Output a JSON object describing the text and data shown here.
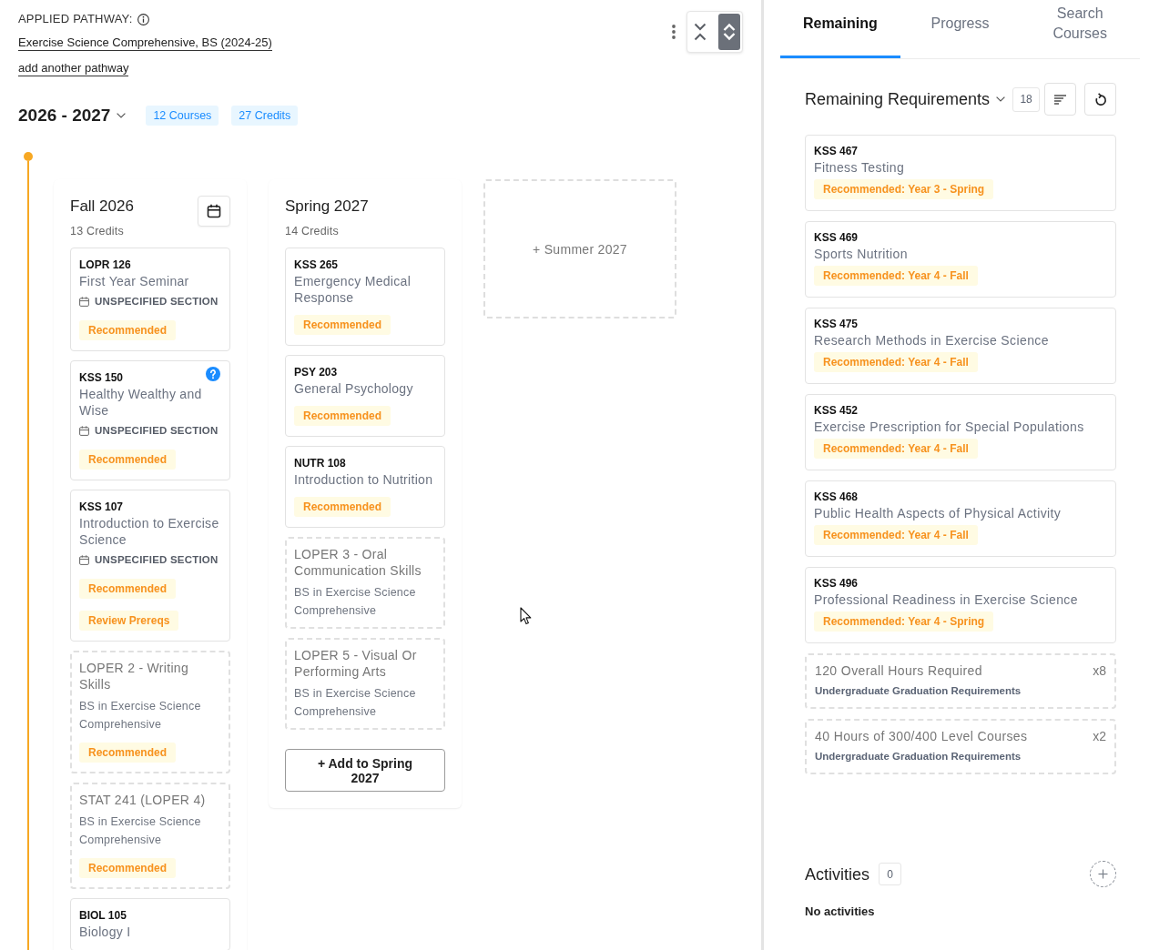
{
  "pathway": {
    "label": "APPLIED PATHWAY:",
    "name": "Exercise Science Comprehensive, BS (2024-25)",
    "add_link": "add another pathway"
  },
  "toolbar": {
    "view_toggle": [
      {
        "kind": "collapse",
        "selected": false
      },
      {
        "kind": "expand",
        "selected": true
      }
    ]
  },
  "year": {
    "title": "2026 - 2027",
    "badges": [
      "12 Courses",
      "27 Credits"
    ]
  },
  "terms": [
    {
      "kind": "term",
      "title": "Fall 2026",
      "credits": "13 Credits",
      "calendar_button": true,
      "cards": [
        {
          "kind": "course",
          "code": "LOPR 126",
          "title": "First Year Seminar",
          "section": "UNSPECIFIED SECTION",
          "help": false,
          "badges": [
            "Recommended"
          ]
        },
        {
          "kind": "course",
          "code": "KSS 150",
          "title": "Healthy Wealthy and Wise",
          "section": "UNSPECIFIED SECTION",
          "help": true,
          "badges": [
            "Recommended"
          ]
        },
        {
          "kind": "course",
          "code": "KSS 107",
          "title": "Introduction to Exercise Science",
          "section": "UNSPECIFIED SECTION",
          "help": false,
          "badges": [
            "Recommended",
            "Review Prereqs"
          ]
        },
        {
          "kind": "requirement",
          "title": "LOPER 2 - Writing Skills",
          "program": "BS in Exercise Science Comprehensive",
          "badges": [
            "Recommended"
          ]
        },
        {
          "kind": "requirement",
          "title": "STAT 241 (LOPER 4)",
          "program": "BS in Exercise Science Comprehensive",
          "badges": [
            "Recommended"
          ]
        },
        {
          "kind": "course",
          "code": "BIOL 105",
          "title": "Biology I",
          "help": false
        }
      ]
    },
    {
      "kind": "term",
      "title": "Spring 2027",
      "credits": "14 Credits",
      "calendar_button": false,
      "cards": [
        {
          "kind": "course",
          "code": "KSS 265",
          "title": "Emergency Medical Response",
          "help": false,
          "badges": [
            "Recommended"
          ]
        },
        {
          "kind": "course",
          "code": "PSY 203",
          "title": "General Psychology",
          "help": false,
          "badges": [
            "Recommended"
          ]
        },
        {
          "kind": "course",
          "code": "NUTR 108",
          "title": "Introduction to Nutrition",
          "help": false,
          "badges": [
            "Recommended"
          ]
        },
        {
          "kind": "requirement",
          "title": "LOPER 3 - Oral Communication Skills",
          "program": "BS in Exercise Science Comprehensive"
        },
        {
          "kind": "requirement",
          "title": "LOPER 5 - Visual Or Performing Arts",
          "program": "BS in Exercise Science Comprehensive"
        }
      ],
      "add_button": "+ Add to Spring 2027"
    },
    {
      "kind": "add_term",
      "label": "+ Summer 2027"
    }
  ],
  "tabs": [
    {
      "label": "Remaining",
      "selected": true
    },
    {
      "label": "Progress",
      "selected": false
    },
    {
      "label": "Search Courses",
      "selected": false
    }
  ],
  "remaining": {
    "title": "Remaining Requirements",
    "count": "18",
    "items": [
      {
        "kind": "course",
        "code": "KSS 467",
        "title": "Fitness Testing",
        "badge": "Recommended: Year 3 - Spring"
      },
      {
        "kind": "course",
        "code": "KSS 469",
        "title": "Sports Nutrition",
        "badge": "Recommended: Year 4 - Fall"
      },
      {
        "kind": "course",
        "code": "KSS 475",
        "title": "Research Methods in Exercise Science",
        "badge": "Recommended: Year 4 - Fall"
      },
      {
        "kind": "course",
        "code": "KSS 452",
        "title": "Exercise Prescription for Special Populations",
        "badge": "Recommended: Year 4 - Fall"
      },
      {
        "kind": "course",
        "code": "KSS 468",
        "title": "Public Health Aspects of Physical Activity",
        "badge": "Recommended: Year 4 - Fall"
      },
      {
        "kind": "course",
        "code": "KSS 496",
        "title": "Professional Readiness in Exercise Science",
        "badge": "Recommended: Year 4 - Spring"
      },
      {
        "kind": "rule",
        "title": "120 Overall Hours Required",
        "multiplier": "x8",
        "source": "Undergraduate Graduation Requirements"
      },
      {
        "kind": "rule",
        "title": "40 Hours of 300/400 Level Courses",
        "multiplier": "x2",
        "source": "Undergraduate Graduation Requirements"
      }
    ]
  },
  "activities": {
    "title": "Activities",
    "count": "0",
    "empty_text": "No activities"
  }
}
